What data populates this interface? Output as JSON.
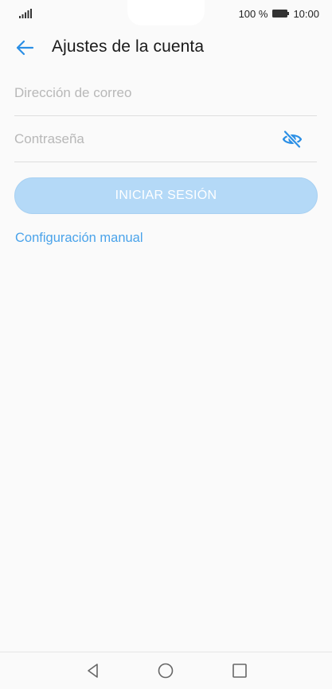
{
  "status_bar": {
    "battery_text": "100 %",
    "time": "10:00"
  },
  "header": {
    "title": "Ajustes de la cuenta"
  },
  "form": {
    "email_placeholder": "Dirección de correo",
    "email_value": "",
    "password_placeholder": "Contraseña",
    "password_value": "",
    "login_label": "INICIAR SESIÓN",
    "manual_link": "Configuración manual"
  },
  "colors": {
    "accent": "#2b8fe5",
    "link": "#4aa3ea",
    "button_disabled": "#b4d9f7"
  },
  "icons": {
    "back": "arrow-left-icon",
    "password_visibility": "eye-off-icon",
    "nav_back": "triangle-back-icon",
    "nav_home": "circle-home-icon",
    "nav_recent": "square-recent-icon"
  }
}
